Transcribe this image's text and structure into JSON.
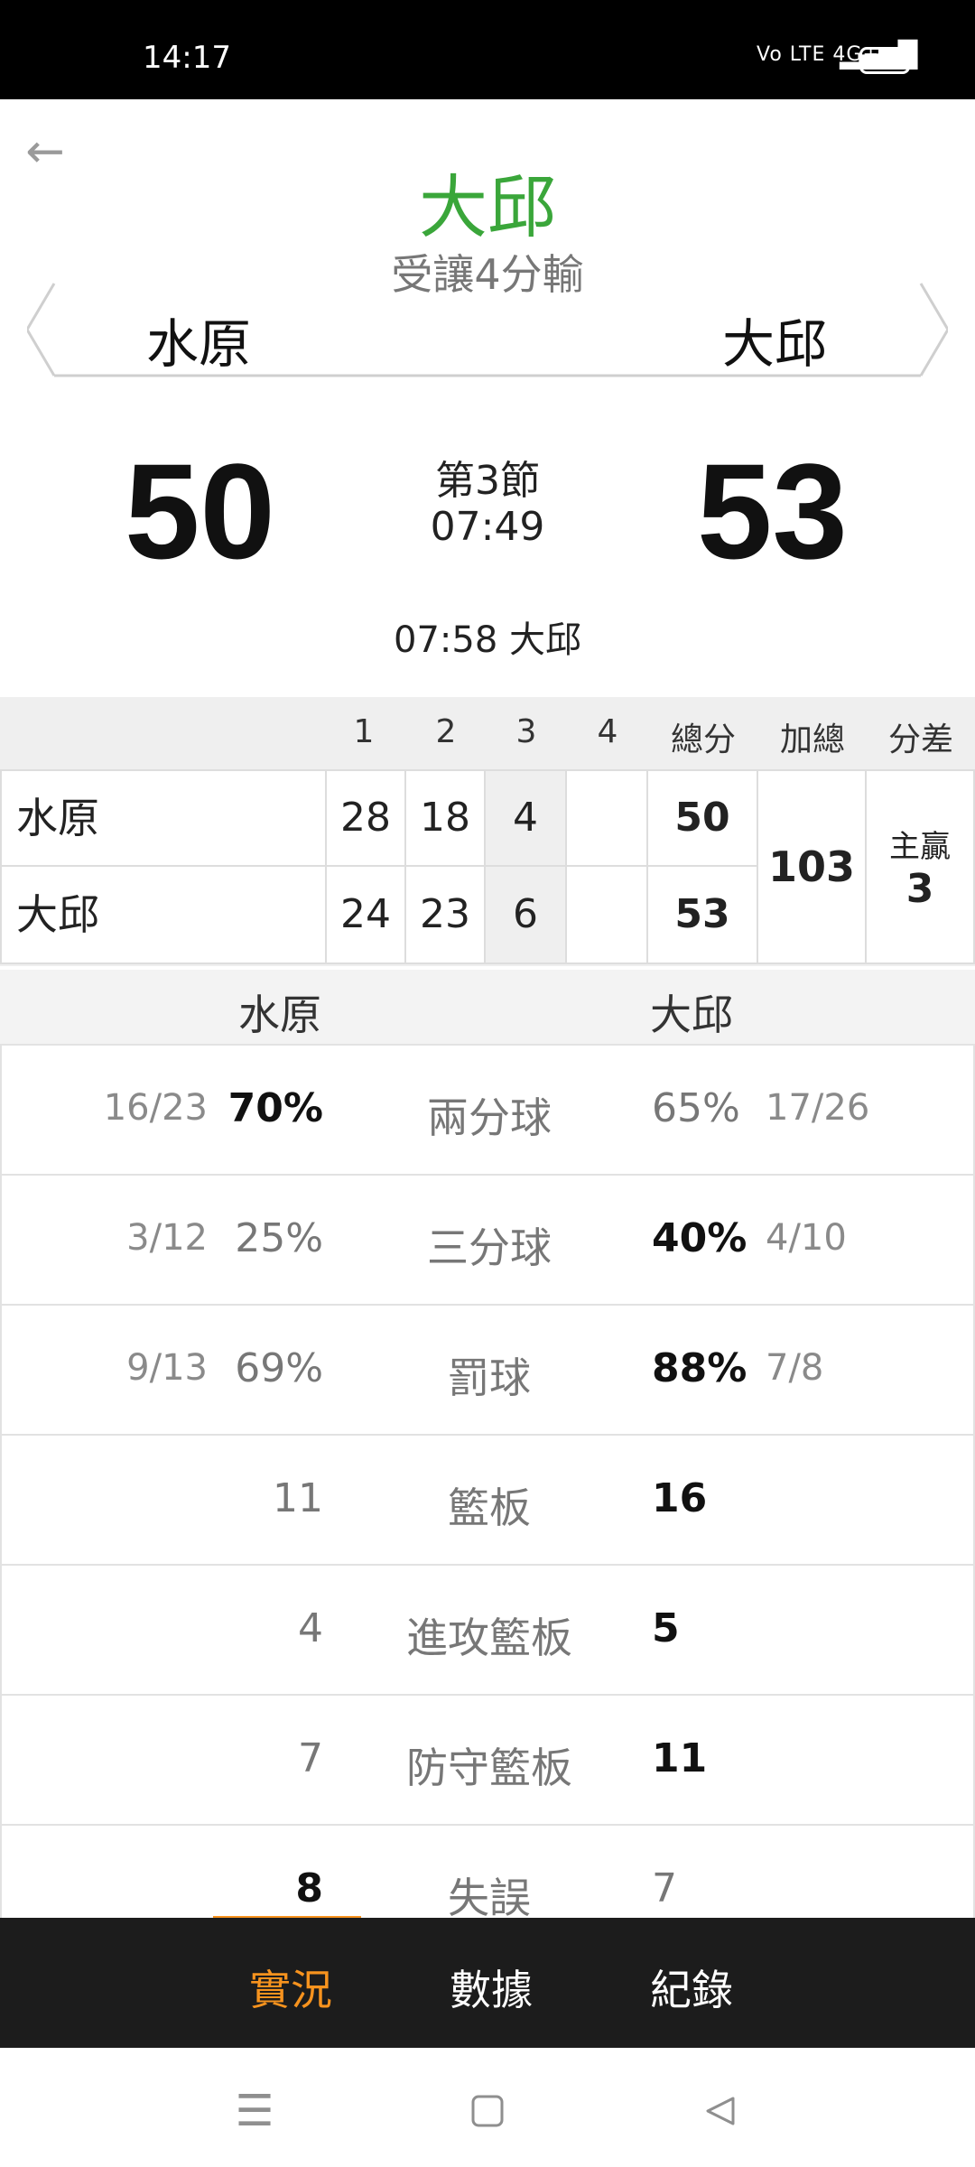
{
  "status_bar": {
    "time": "14:17",
    "network": "Vo LTE 4G+",
    "battery": "81"
  },
  "header": {
    "winner": "大邱",
    "handicap_result": "受讓4分輸",
    "home_team": "水原",
    "away_team": "大邱",
    "home_score": "50",
    "away_score": "53",
    "period": "第3節",
    "clock": "07:49",
    "last_score": "07:58 大邱"
  },
  "quarter_table": {
    "headers": [
      "1",
      "2",
      "3",
      "4",
      "總分",
      "加總",
      "分差"
    ],
    "rows": [
      {
        "team": "水原",
        "q1": "28",
        "q2": "18",
        "q3": "4",
        "q4": "",
        "total": "50"
      },
      {
        "team": "大邱",
        "q1": "24",
        "q2": "23",
        "q3": "6",
        "q4": "",
        "total": "53"
      }
    ],
    "sum_total": "103",
    "diff_label": "主贏",
    "diff_value": "3"
  },
  "stats_header": {
    "home": "水原",
    "away": "大邱"
  },
  "stats": [
    {
      "label": "兩分球",
      "home_frac": "16/23",
      "home_val": "70%",
      "away_val": "65%",
      "away_frac": "17/26"
    },
    {
      "label": "三分球",
      "home_frac": "3/12",
      "home_val": "25%",
      "away_val": "40%",
      "away_frac": "4/10"
    },
    {
      "label": "罰球",
      "home_frac": "9/13",
      "home_val": "69%",
      "away_val": "88%",
      "away_frac": "7/8"
    },
    {
      "label": "籃板",
      "home_frac": "",
      "home_val": "11",
      "away_val": "16",
      "away_frac": ""
    },
    {
      "label": "進攻籃板",
      "home_frac": "",
      "home_val": "4",
      "away_val": "5",
      "away_frac": ""
    },
    {
      "label": "防守籃板",
      "home_frac": "",
      "home_val": "7",
      "away_val": "11",
      "away_frac": ""
    },
    {
      "label": "失誤",
      "home_frac": "",
      "home_val": "8",
      "away_val": "7",
      "away_frac": ""
    }
  ],
  "tabs": [
    "實況",
    "數據",
    "紀錄"
  ],
  "colors": {
    "accent": "#f7931e",
    "winner_green": "#3aa63a",
    "tabbar_bg": "#1c1c1c"
  },
  "icons": {
    "back": "arrow-left-icon",
    "nav_menu": "menu-icon",
    "nav_home": "square-icon",
    "nav_back": "triangle-back-icon"
  }
}
